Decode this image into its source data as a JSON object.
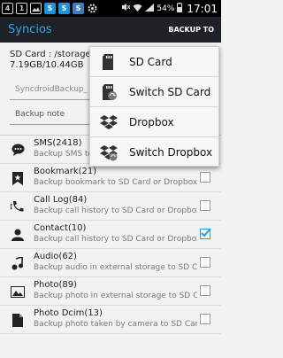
{
  "status_bar": {
    "left_icons": [
      "4",
      "1",
      "S",
      "S",
      "S"
    ],
    "battery": "54%",
    "time": "17:01"
  },
  "action_bar": {
    "title": "Syncios",
    "backup_to": "BACKUP TO"
  },
  "header": {
    "sd_card_path": "SD Card : /storage/e",
    "sd_card_usage": "7.19GB/10.44GB",
    "folder_field": "SyncdroidBackup_",
    "note_placeholder": "Backup note"
  },
  "menu": {
    "items": [
      {
        "label": "SD Card",
        "icon": "sd-card-icon"
      },
      {
        "label": "Switch SD Card",
        "icon": "switch-sd-card-icon"
      },
      {
        "label": "Dropbox",
        "icon": "dropbox-icon"
      },
      {
        "label": "Switch Dropbox",
        "icon": "switch-dropbox-icon"
      }
    ]
  },
  "list": {
    "items": [
      {
        "title": "SMS(2418)",
        "subtitle": "Backup SMS to SD Card or Dropbox",
        "checked": false
      },
      {
        "title": "Bookmark(21)",
        "subtitle": "Backup bookmark to SD Card or Dropbox",
        "checked": false
      },
      {
        "title": "Call Log(84)",
        "subtitle": "Backup call history to SD Card or Dropbox",
        "checked": false
      },
      {
        "title": "Contact(10)",
        "subtitle": "Backup call history to SD Card or Dropbox",
        "checked": true
      },
      {
        "title": "Audio(62)",
        "subtitle": "Backup audio in external storage to SD Card",
        "checked": false
      },
      {
        "title": "Photo(89)",
        "subtitle": "Backup photo in external storage to SD Card",
        "checked": false
      },
      {
        "title": "Photo Dcim(13)",
        "subtitle": "Backup photo taken by camera to SD Card",
        "checked": false
      }
    ]
  },
  "colors": {
    "accent": "#35a4e6",
    "action_bar": "#1e2227",
    "check": "#2a9fd6"
  }
}
